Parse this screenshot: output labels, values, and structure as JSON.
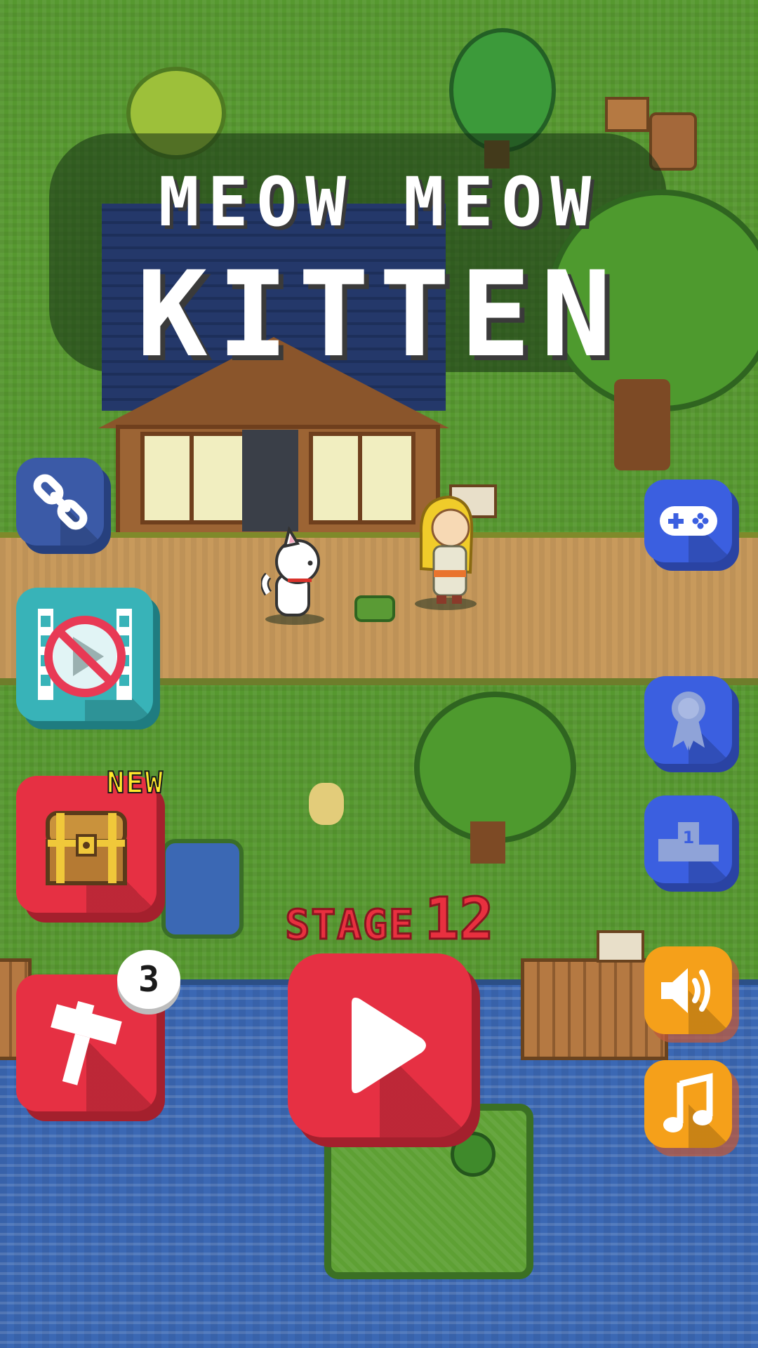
{
  "title": {
    "line1": "MEOW MEOW",
    "line2": "KITTEN"
  },
  "stage": {
    "label": "STAGE",
    "number": "12"
  },
  "badges": {
    "new_label": "NEW",
    "tool_count": "3"
  },
  "buttons": [
    {
      "id": "link",
      "icon": "link-icon",
      "color": "#3b5aa7"
    },
    {
      "id": "no-ads",
      "icon": "no-ads-icon",
      "color": "#38b3b8"
    },
    {
      "id": "chest",
      "icon": "treasure-chest-icon",
      "color": "#e63043"
    },
    {
      "id": "hammer",
      "icon": "hammer-icon",
      "color": "#e63043"
    },
    {
      "id": "play",
      "icon": "play-icon",
      "color": "#e63043"
    },
    {
      "id": "games",
      "icon": "gamepad-icon",
      "color": "#3b5fe0"
    },
    {
      "id": "achievements",
      "icon": "ribbon-icon",
      "color": "#3b5fe0"
    },
    {
      "id": "leaderboard",
      "icon": "podium-icon",
      "color": "#3b5fe0"
    },
    {
      "id": "sound",
      "icon": "speaker-icon",
      "color": "#f5a01a"
    },
    {
      "id": "music",
      "icon": "music-note-icon",
      "color": "#f5a01a"
    }
  ]
}
